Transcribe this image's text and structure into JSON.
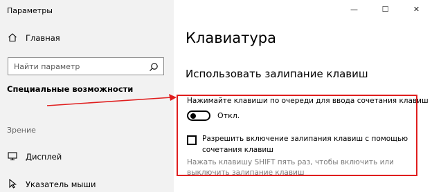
{
  "app": {
    "title": "Параметры"
  },
  "sidebar": {
    "home_label": "Главная",
    "search_placeholder": "Найти параметр",
    "section_title": "Специальные возможности",
    "group_label": "Зрение",
    "items": [
      {
        "label": "Дисплей",
        "icon": "display-icon"
      },
      {
        "label": "Указатель мыши",
        "icon": "mouse-pointer-icon"
      }
    ]
  },
  "window_controls": {
    "minimize": "—",
    "maximize": "☐",
    "close": "✕"
  },
  "main": {
    "title": "Клавиатура",
    "sticky_keys": {
      "heading": "Использовать залипание клавиш",
      "description": "Нажимайте клавиши по очереди для ввода сочетания клавиш",
      "toggle_state": "Откл.",
      "checkbox_label": "Разрешить включение залипания клавиш с помощью сочетания клавиш",
      "hint": "Нажать клавишу SHIFT пять раз, чтобы включить или выключить залипание клавиш"
    }
  },
  "colors": {
    "sidebar_bg": "#f2f2f2",
    "annotation_red": "#e01e1e",
    "hint_text": "#7a7a7a"
  }
}
